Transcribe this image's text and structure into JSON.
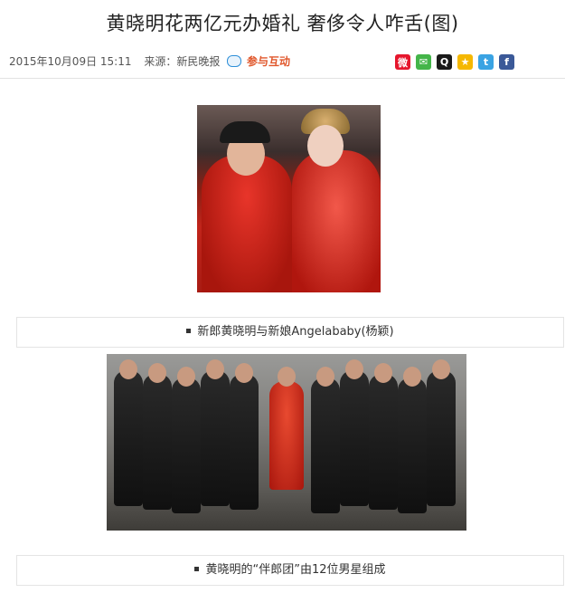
{
  "article": {
    "title": "黄晓明花两亿元办婚礼 奢侈令人咋舌(图)",
    "date": "2015年10月09日 15:11",
    "source": "来源：新民晚报",
    "interact_label": "参与互动"
  },
  "share_icons": [
    {
      "name": "weibo-icon",
      "glyph": "微",
      "color": "#e6162d"
    },
    {
      "name": "wechat-icon",
      "glyph": "✉",
      "color": "#44b549"
    },
    {
      "name": "qq-icon",
      "glyph": "Q",
      "color": "#1a1a1a"
    },
    {
      "name": "qzone-icon",
      "glyph": "★",
      "color": "#f5b800"
    },
    {
      "name": "tencent-weibo-icon",
      "glyph": "t",
      "color": "#3aa3e3"
    },
    {
      "name": "facebook-icon",
      "glyph": "f",
      "color": "#3b5998"
    }
  ],
  "figures": [
    {
      "caption": "新郎黄晓明与新娘Angelababy(杨颖)"
    },
    {
      "caption": "黄晓明的“伴郎团”由12位男星组成"
    }
  ]
}
